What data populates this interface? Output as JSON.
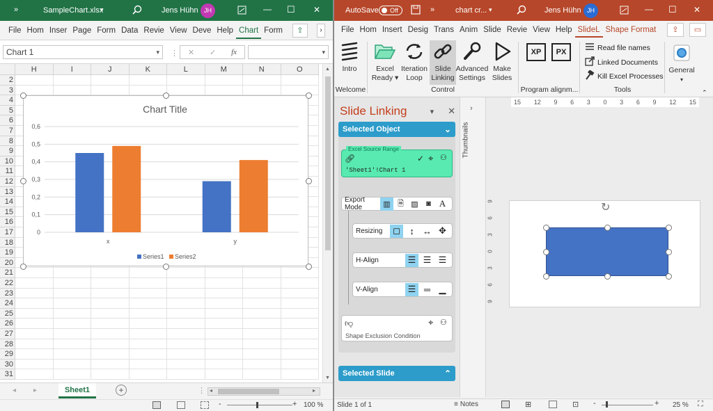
{
  "excel": {
    "title": {
      "overflow": "»",
      "filename": "SampleChart.xlsx",
      "dropdown": "▾",
      "user": "Jens Hühn",
      "initials": "JH",
      "min": "—",
      "max": "☐",
      "close": "✕"
    },
    "tabs": [
      "File",
      "Hom",
      "Inser",
      "Page",
      "Form",
      "Data",
      "Revie",
      "View",
      "Deve",
      "Help",
      "Chart",
      "Form"
    ],
    "active_tab": "Chart",
    "namebox": "Chart 1",
    "fx": "fx",
    "columns": [
      "H",
      "I",
      "J",
      "K",
      "L",
      "M",
      "N",
      "O"
    ],
    "rows": [
      "2",
      "3",
      "4",
      "5",
      "6",
      "7",
      "8",
      "9",
      "10",
      "11",
      "12",
      "13",
      "14",
      "15",
      "16",
      "17",
      "18",
      "19",
      "20",
      "21",
      "22",
      "23",
      "24",
      "25",
      "26",
      "27",
      "28",
      "29",
      "30",
      "31"
    ],
    "sheet_tab": "Sheet1",
    "add_sheet": "+",
    "status_zoom": "100 %",
    "status_minus": "-",
    "status_plus": "+"
  },
  "chart_data": {
    "type": "bar",
    "title": "Chart Title",
    "categories": [
      "x",
      "y"
    ],
    "series": [
      {
        "name": "Series1",
        "values": [
          0.45,
          0.29
        ],
        "color": "#4472c4"
      },
      {
        "name": "Series2",
        "values": [
          0.49,
          0.41
        ],
        "color": "#ed7d31"
      }
    ],
    "yticks": [
      "0",
      "0,1",
      "0,2",
      "0,3",
      "0,4",
      "0,5",
      "0,6"
    ],
    "ylim": [
      0,
      0.6
    ],
    "grid": true,
    "legend": "bottom"
  },
  "ppt": {
    "title": {
      "autosave": "AutoSave",
      "toggle": "Off",
      "overflow": "»",
      "filename": "chart cr...",
      "dropdown": "▾",
      "user": "Jens Hühn",
      "initials": "JH",
      "min": "—",
      "max": "☐",
      "close": "✕"
    },
    "tabs": [
      "File",
      "Hom",
      "Insert",
      "Desig",
      "Trans",
      "Anim",
      "Slide",
      "Revie",
      "View",
      "Help",
      "SlideL",
      "Shape Format"
    ],
    "active_tab": "SlideL",
    "ribbon": {
      "intro": "Intro",
      "excel_ready": "Excel Ready ▾",
      "iteration": "Iteration Loop",
      "slide_linking": "Slide Linking",
      "advanced": "Advanced Settings",
      "make_slides": "Make Slides",
      "xp": "XP",
      "px": "PX",
      "read_file_names": "Read file names",
      "linked_docs": "Linked Documents",
      "kill_excel": "Kill Excel Processes",
      "general": "General",
      "group_welcome": "Welcome",
      "group_control": "Control",
      "group_program": "Program alignm...",
      "group_tools": "Tools"
    },
    "pane": {
      "title": "Slide Linking",
      "dropdown": "▾",
      "close": "✕",
      "selected_object": "Selected Object",
      "source_range_label": "Excel Source Range",
      "source_range_value": "'Sheet1'!Chart 1",
      "export_mode": "Export Mode",
      "resizing": "Resizing",
      "halign": "H-Align",
      "valign": "V-Align",
      "shape_exclusion": "Shape Exclusion Condition",
      "selected_slide": "Selected Slide"
    },
    "thumbnails": "Thumbnails",
    "ruler_h": [
      "15",
      "12",
      "9",
      "6",
      "3",
      "0",
      "3",
      "6",
      "9",
      "12",
      "15"
    ],
    "ruler_v": [
      "9",
      "6",
      "3",
      "0",
      "3",
      "6",
      "9"
    ],
    "status": {
      "slide": "Slide 1 of 1",
      "notes": "Notes",
      "zoom": "25 %",
      "minus": "-",
      "plus": "+"
    },
    "shape_color": "#4472c4"
  }
}
